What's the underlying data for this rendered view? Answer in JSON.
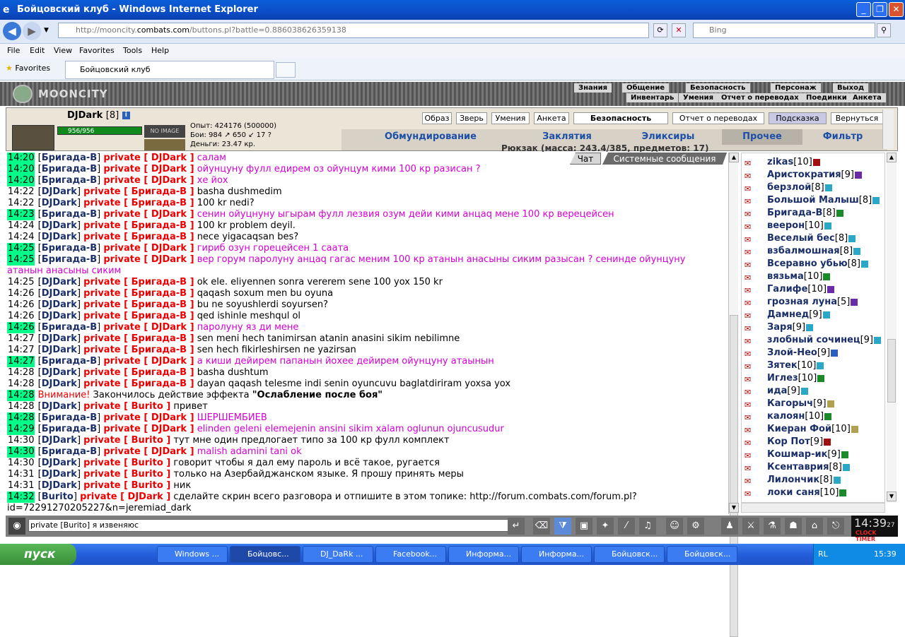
{
  "window": {
    "title": "Бойцовский клуб - Windows Internet Explorer"
  },
  "browser": {
    "url_prefix": "http://mooncity.",
    "url_domain": "combats.com",
    "url_rest": "/buttons.pl?battle=0.886038626359138",
    "search_placeholder": "Bing",
    "menu": [
      "File",
      "Edit",
      "View",
      "Favorites",
      "Tools",
      "Help"
    ],
    "favorites_label": "Favorites",
    "tab_title": "Бойцовский клуб"
  },
  "game": {
    "logo": "MOONCITY",
    "top_menu_row1": [
      "Знания",
      "Общение",
      "Безопасность",
      "Персонаж",
      "Выход"
    ],
    "top_menu_row2": [
      "Инвентарь",
      "Умения",
      "Отчет о переводах",
      "Поединки",
      "Анкета"
    ],
    "character": {
      "nick": "DJDark",
      "level": "[8]",
      "hp": "956/956",
      "no_image": "NO IMAGE",
      "stats": [
        "Опыт: 424176 (500000)",
        "Бои:  984 ↗  650 ↙  17 ?",
        "Деньги: 23.47 кр."
      ]
    },
    "panel_buttons": [
      "Образ",
      "Зверь",
      "Умения",
      "Анкета",
      "Безопасность",
      "Отчет о переводах",
      "Подсказка",
      "Вернуться"
    ],
    "categories": [
      "Обмундирование",
      "Заклятия",
      "Эликсиры",
      "Прочее",
      "Фильтр"
    ],
    "backpack": "Рюкзак (масса: 243.4/385, предметов: 17)",
    "chat_tabs": [
      "Чат",
      "Системные сообщения"
    ],
    "chat": [
      {
        "t": "14:20",
        "hl": true,
        "from": "Бригада-В",
        "to": "DJDark",
        "msg": "салам",
        "pink": true
      },
      {
        "t": "14:20",
        "hl": true,
        "from": "Бригада-В",
        "to": "DJDark",
        "msg": "ойунцуну фулл едирем оз ойунцум кими 100 кр разисан ?",
        "pink": true
      },
      {
        "t": "14:20",
        "hl": true,
        "from": "Бригада-В",
        "to": "DJDark",
        "msg": "хе йох",
        "pink": true
      },
      {
        "t": "14:22",
        "hl": false,
        "from": "DJDark",
        "to": "Бригада-В",
        "msg": "basha dushmedim",
        "pink": false
      },
      {
        "t": "14:22",
        "hl": false,
        "from": "DJDark",
        "to": "Бригада-В",
        "msg": "100 kr nedi?",
        "pink": false
      },
      {
        "t": "14:23",
        "hl": true,
        "from": "Бригада-В",
        "to": "DJDark",
        "msg": "сенин ойуцнуну ыгырам фулл лезвия озум дейи кими анцаq мене 100 кр верецейсен",
        "pink": true
      },
      {
        "t": "14:24",
        "hl": false,
        "from": "DJDark",
        "to": "Бригада-В",
        "msg": "100 kr problem deyil.",
        "pink": false
      },
      {
        "t": "14:24",
        "hl": false,
        "from": "DJDark",
        "to": "Бригада-В",
        "msg": "nece yigacaqsan bes?",
        "pink": false
      },
      {
        "t": "14:25",
        "hl": true,
        "from": "Бригада-В",
        "to": "DJDark",
        "msg": "гириб озун горецейсен 1 саата",
        "pink": true
      },
      {
        "t": "14:25",
        "hl": true,
        "from": "Бригада-В",
        "to": "DJDark",
        "msg": "вер горум паролуну анцаq гагас меним 100 кр атанын анасыны сиким разысан ? сенинде ойунцуну атанын анасыны сиким",
        "pink": true,
        "wrap": true
      },
      {
        "t": "14:25",
        "hl": false,
        "from": "DJDark",
        "to": "Бригада-В",
        "msg": "ok ele. eliyennen sonra vererem sene 100 yox 150 kr",
        "pink": false
      },
      {
        "t": "14:26",
        "hl": false,
        "from": "DJDark",
        "to": "Бригада-В",
        "msg": "qaqash soxum men bu oyuna",
        "pink": false
      },
      {
        "t": "14:26",
        "hl": false,
        "from": "DJDark",
        "to": "Бригада-В",
        "msg": "bu ne soyushlerdi soyursen?",
        "pink": false
      },
      {
        "t": "14:26",
        "hl": false,
        "from": "DJDark",
        "to": "Бригада-В",
        "msg": "qed ishinle meshqul ol",
        "pink": false
      },
      {
        "t": "14:26",
        "hl": true,
        "from": "Бригада-В",
        "to": "DJDark",
        "msg": "паролуну яз ди мене",
        "pink": true
      },
      {
        "t": "14:27",
        "hl": false,
        "from": "DJDark",
        "to": "Бригада-В",
        "msg": "sen meni hech tanimirsan atanin anasini sikim nebilimne",
        "pink": false
      },
      {
        "t": "14:27",
        "hl": false,
        "from": "DJDark",
        "to": "Бригада-В",
        "msg": "sen hech fikirleshirsen ne yazirsan",
        "pink": false
      },
      {
        "t": "14:27",
        "hl": true,
        "from": "Бригада-В",
        "to": "DJDark",
        "msg": "а киши дейирем папанын йохее дейирем ойунцуну атаынын",
        "pink": true
      },
      {
        "t": "14:28",
        "hl": false,
        "from": "DJDark",
        "to": "Бригада-В",
        "msg": "basha dushtum",
        "pink": false
      },
      {
        "t": "14:28",
        "hl": false,
        "from": "DJDark",
        "to": "Бригада-В",
        "msg": "dayan qaqash telesme indi senin oyuncuvu baglatdiriram yoxsa yox",
        "pink": false
      },
      {
        "t": "14:28",
        "hl": true,
        "system": true,
        "warn": "Внимание!",
        "pre": " Закончилось действие эффекта ",
        "effect": "\"Ослабление после боя\""
      },
      {
        "t": "14:28",
        "hl": false,
        "from": "DJDark",
        "to": "Burito",
        "msg": "привет",
        "pink": false
      },
      {
        "t": "14:28",
        "hl": true,
        "from": "Бригада-В",
        "to": "DJDark",
        "msg": "ШЕРШЕМБИЕВ",
        "pink": true
      },
      {
        "t": "14:29",
        "hl": true,
        "from": "Бригада-В",
        "to": "DJDark",
        "msg": "elinden geleni elemejenin ansini sikim xalam oglunun ojuncusudur",
        "pink": true
      },
      {
        "t": "14:30",
        "hl": false,
        "from": "DJDark",
        "to": "Burito",
        "msg": "тут мне один предлогает типо за 100 кр фулл комплект",
        "pink": false
      },
      {
        "t": "14:30",
        "hl": true,
        "from": "Бригада-В",
        "to": "DJDark",
        "msg": "malish adamini tani ok",
        "pink": true
      },
      {
        "t": "14:30",
        "hl": false,
        "from": "DJDark",
        "to": "Burito",
        "msg": "говорит чтобы я дал ему пароль и всё такое, ругается",
        "pink": false
      },
      {
        "t": "14:31",
        "hl": false,
        "from": "DJDark",
        "to": "Burito",
        "msg": "только на Азербайджанском языке. Я прошу принять меры",
        "pink": false
      },
      {
        "t": "14:31",
        "hl": false,
        "from": "DJDark",
        "to": "Burito",
        "msg": "ник",
        "pink": false
      },
      {
        "t": "14:32",
        "hl": true,
        "from": "Burito",
        "to": "DJDark",
        "msg": "сделайте скрин всего разговора и отпишите в этом топике: http://forum.combats.com/forum.pl?id=72291270205227&n=jeremiad_dark",
        "pink": false,
        "wrap": true
      }
    ],
    "users": [
      {
        "name": "zikas",
        "lvl": "[10]",
        "tag": "#a01010"
      },
      {
        "name": "Аристократия",
        "lvl": "[9]",
        "tag": "#6a2ba8"
      },
      {
        "name": "берзлой",
        "lvl": "[8]",
        "tag": "#2ba8c8"
      },
      {
        "name": "Большой Малыш",
        "lvl": "[8]",
        "tag": "#2ba8c8"
      },
      {
        "name": "Бригада-В",
        "lvl": "[8]",
        "tag": "#1a8a2a"
      },
      {
        "name": "веерон",
        "lvl": "[10]",
        "tag": "#2ba8c8"
      },
      {
        "name": "Веселый бес",
        "lvl": "[8]",
        "tag": "#2ba8c8"
      },
      {
        "name": "взбалмошная",
        "lvl": "[8]",
        "tag": "#2ba8c8"
      },
      {
        "name": "Всеравно убью",
        "lvl": "[8]",
        "tag": "#2ba8c8"
      },
      {
        "name": "вязьма",
        "lvl": "[10]",
        "tag": "#1a8a2a"
      },
      {
        "name": "Галифе",
        "lvl": "[10]",
        "tag": "#6a2ba8"
      },
      {
        "name": "грозная луна",
        "lvl": "[5]",
        "tag": "#6a2ba8"
      },
      {
        "name": "Дамнед",
        "lvl": "[9]",
        "tag": "#2ba8c8"
      },
      {
        "name": "Заря",
        "lvl": "[9]",
        "tag": "#2ba8c8"
      },
      {
        "name": "злобный сочинец",
        "lvl": "[9]",
        "tag": "#2ba8c8"
      },
      {
        "name": "Злой-Нео",
        "lvl": "[9]",
        "tag": "#2a5fbf"
      },
      {
        "name": "Зятек",
        "lvl": "[10]",
        "tag": "#2ba8c8"
      },
      {
        "name": "Иглез",
        "lvl": "[10]",
        "tag": "#1a8a2a"
      },
      {
        "name": "ида",
        "lvl": "[9]",
        "tag": "#2ba8c8"
      },
      {
        "name": "Кагорыч",
        "lvl": "[9]",
        "tag": "#b0a050"
      },
      {
        "name": "калоян",
        "lvl": "[10]",
        "tag": "#1a8a2a"
      },
      {
        "name": "Киеран Фой",
        "lvl": "[10]",
        "tag": "#b0a050"
      },
      {
        "name": "Кор Пот",
        "lvl": "[9]",
        "tag": "#a01010"
      },
      {
        "name": "Кошмар-ик",
        "lvl": "[9]",
        "tag": "#1a8a2a"
      },
      {
        "name": "Ксентаврия",
        "lvl": "[8]",
        "tag": "#2ba8c8"
      },
      {
        "name": "Лилончик",
        "lvl": "[8]",
        "tag": "#2ba8c8"
      },
      {
        "name": "локи саня",
        "lvl": "[10]",
        "tag": "#1a8a2a"
      }
    ],
    "chat_input": "private [Burito] я извеняюс",
    "clock": "14:39",
    "clock_sec": "27",
    "clock_label": "CLOCK TIMER"
  },
  "taskbar": {
    "start": "пуск",
    "items": [
      "Windows ...",
      "Бойцовс...",
      "DJ_DaRk ...",
      "Facebook...",
      "Информа...",
      "Информа...",
      "Бойцовск...",
      "Бойцовск..."
    ],
    "lang": "RL",
    "time": "15:39"
  }
}
